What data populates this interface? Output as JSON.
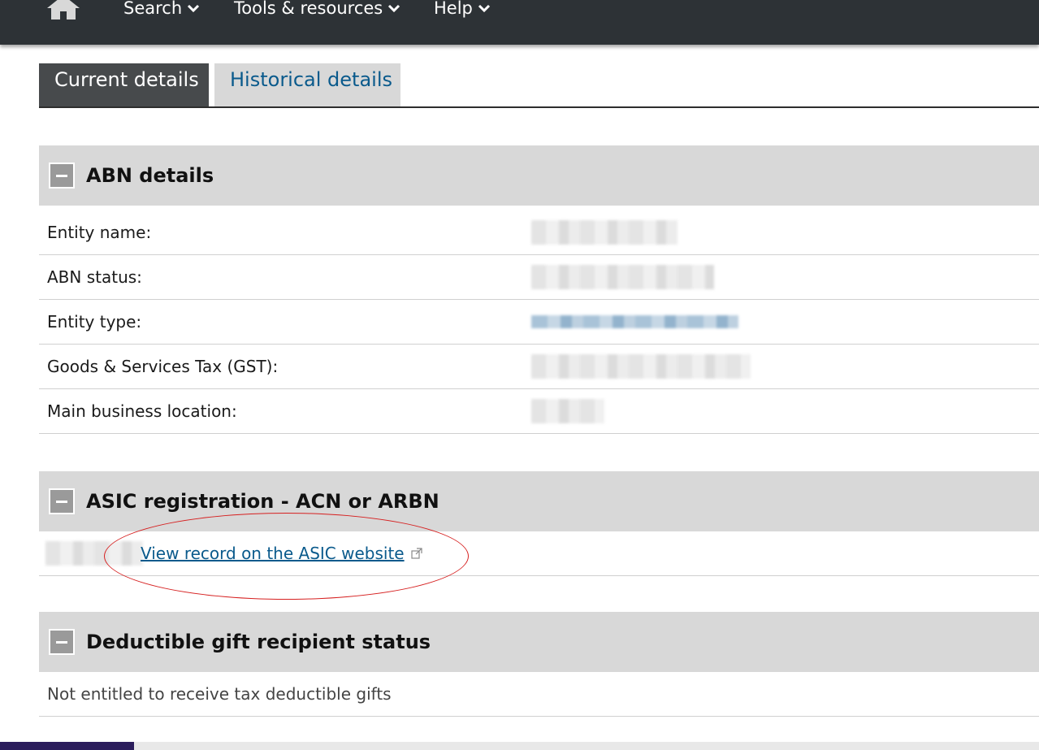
{
  "nav": {
    "items": [
      "Search",
      "Tools & resources",
      "Help"
    ]
  },
  "tabs": {
    "current": "Current details",
    "historical": "Historical details"
  },
  "abn_section": {
    "title": "ABN details",
    "rows": [
      {
        "label": "Entity name:"
      },
      {
        "label": "ABN status:"
      },
      {
        "label": "Entity type:"
      },
      {
        "label": "Goods & Services Tax (GST):"
      },
      {
        "label": "Main business location:"
      }
    ]
  },
  "asic_section": {
    "title": "ASIC registration - ACN or ARBN",
    "link_label": "View record on the ASIC website"
  },
  "dgr_section": {
    "title": "Deductible gift recipient status",
    "text": "Not entitled to receive tax deductible gifts"
  },
  "colors": {
    "nav_bg": "#2d3236",
    "tab_active_bg": "#474a4c",
    "tab_inactive_bg": "#d8d8d8",
    "link": "#0a5a8c",
    "section_header_bg": "#d8d8d8",
    "annotation_ellipse": "#d62020"
  }
}
